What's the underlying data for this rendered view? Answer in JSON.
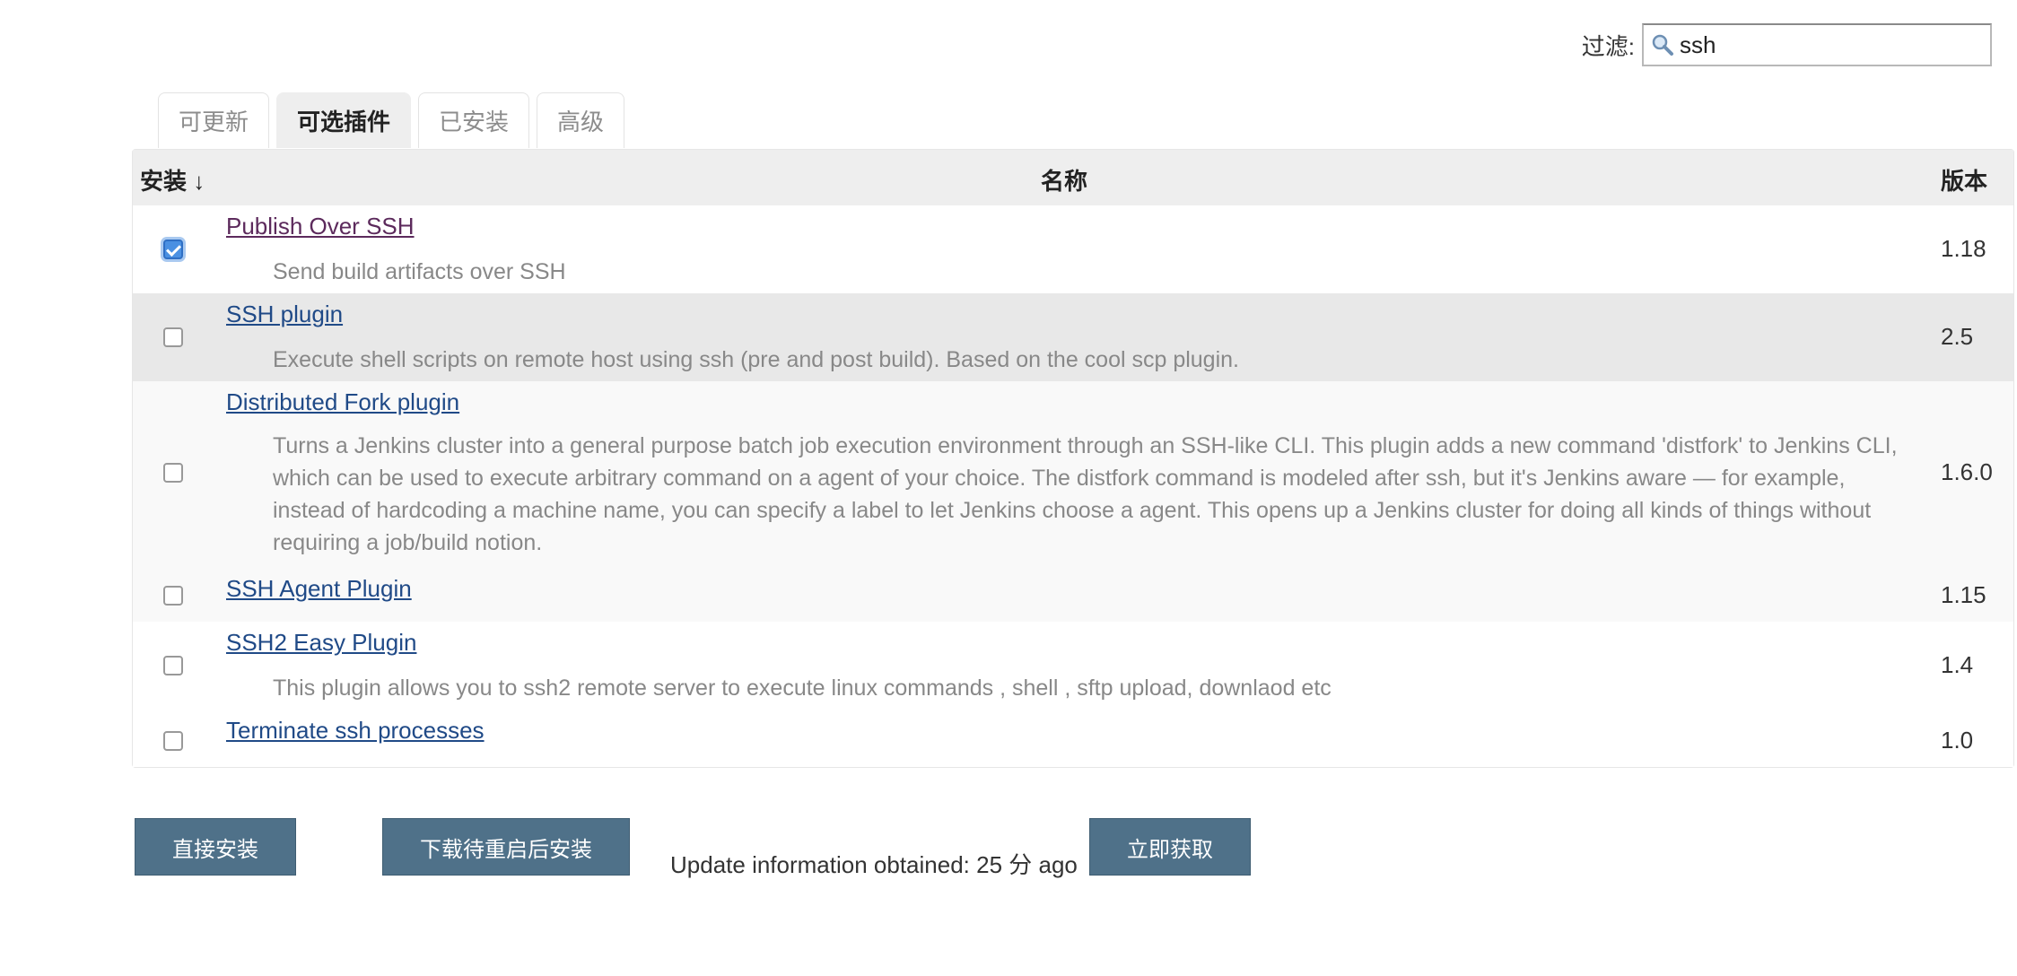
{
  "filter": {
    "label": "过滤:",
    "value": "ssh",
    "icon": "search-icon"
  },
  "tabs": [
    {
      "label": "可更新",
      "active": false
    },
    {
      "label": "可选插件",
      "active": true
    },
    {
      "label": "已安装",
      "active": false
    },
    {
      "label": "高级",
      "active": false
    }
  ],
  "table": {
    "headers": {
      "install": "安装 ↓",
      "name": "名称",
      "version": "版本"
    },
    "rows": [
      {
        "name": "Publish Over SSH",
        "description": "Send build artifacts over SSH",
        "version": "1.18",
        "checked": true
      },
      {
        "name": "SSH plugin",
        "description": "Execute shell scripts on remote host using ssh (pre and post build). Based on the cool scp plugin.",
        "version": "2.5",
        "checked": false
      },
      {
        "name": "Distributed Fork plugin",
        "description": "Turns a Jenkins cluster into a general purpose batch job execution environment through an SSH-like CLI. This plugin adds a new command 'distfork' to Jenkins CLI, which can be used to execute arbitrary command on a agent of your choice. The distfork command is modeled after ssh, but it's Jenkins aware — for example, instead of hardcoding a machine name, you can specify a label to let Jenkins choose a agent. This opens up a Jenkins cluster for doing all kinds of things without requiring a job/build notion.",
        "version": "1.6.0",
        "checked": false
      },
      {
        "name": "SSH Agent Plugin",
        "description": "",
        "version": "1.15",
        "checked": false
      },
      {
        "name": "SSH2 Easy Plugin",
        "description": "This plugin allows you to ssh2 remote server to execute linux commands , shell , sftp upload, downlaod etc",
        "version": "1.4",
        "checked": false
      },
      {
        "name": "Terminate ssh processes",
        "description": "",
        "version": "1.0",
        "checked": false
      }
    ]
  },
  "actions": {
    "install_now": "直接安装",
    "download_restart": "下载待重启后安装",
    "update_info": "Update information obtained: 25 分 ago",
    "check_now": "立即获取"
  },
  "colors": {
    "button": "#4f7189",
    "link": "#204a87",
    "visited_link": "#5c2a5c",
    "header_bg": "#eeeeee",
    "hover_row_bg": "#e8e8e8",
    "alt_row_bg": "#f9f9f9"
  }
}
